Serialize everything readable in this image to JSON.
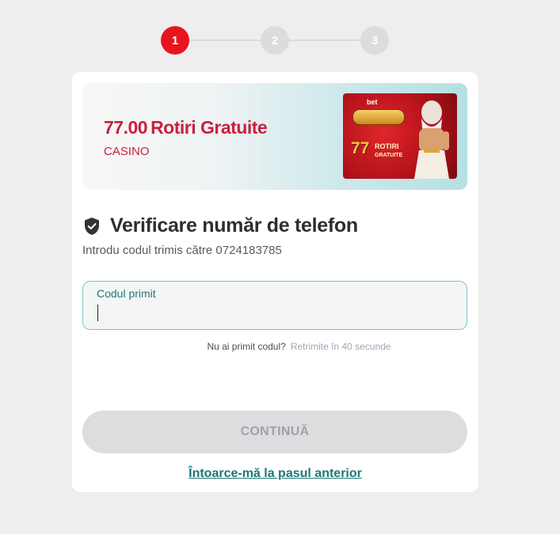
{
  "stepper": {
    "steps": [
      "1",
      "2",
      "3"
    ],
    "active_step": 1
  },
  "promo": {
    "amount": "77.00",
    "title": "Rotiri Gratuite",
    "subtitle": "CASINO",
    "image": {
      "brand": "bet",
      "big_number": "77",
      "line1": "ROTIRI",
      "line2": "GRATUITE"
    }
  },
  "verification": {
    "icon": "shield-check-icon",
    "title": "Verificare număr de telefon",
    "subtitle": "Introdu codul trimis către 0724183785"
  },
  "code_field": {
    "label": "Codul primit",
    "value": ""
  },
  "resend": {
    "question": "Nu ai primit codul?",
    "action": "Retrimite în 40 secunde"
  },
  "continue_button": {
    "label": "CONTINUĂ"
  },
  "back_link": {
    "label": "Întoarce-mă la pasul anterior"
  },
  "colors": {
    "accent_red": "#e8141e",
    "promo_red": "#cc1f3e",
    "teal": "#1e7777",
    "disabled": "#dcdddf"
  }
}
